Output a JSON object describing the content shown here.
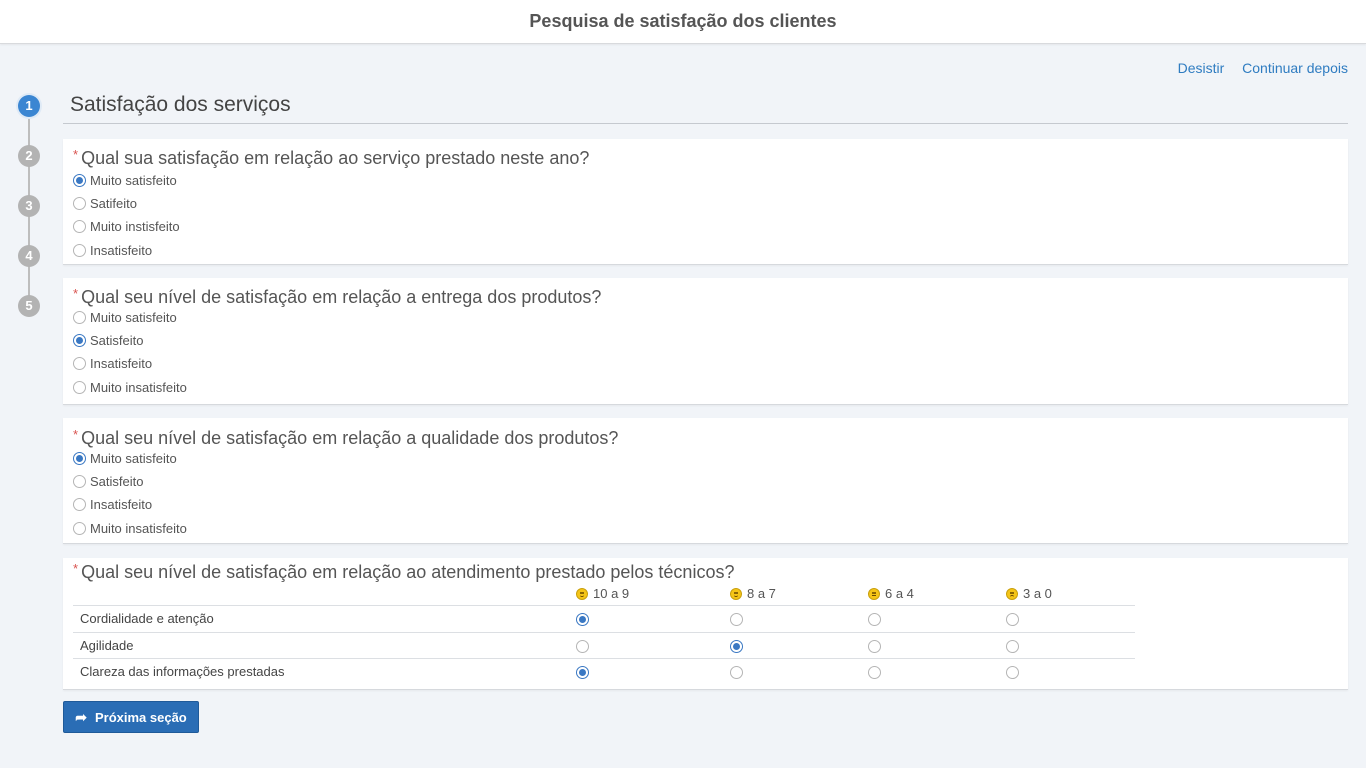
{
  "header": {
    "title": "Pesquisa de satisfação dos clientes"
  },
  "links": {
    "quit": "Desistir",
    "continue_later": "Continuar depois"
  },
  "steps": [
    "1",
    "2",
    "3",
    "4",
    "5"
  ],
  "active_step": 1,
  "section": {
    "title": "Satisfação dos serviços"
  },
  "questions": [
    {
      "required": "*",
      "title": "Qual sua satisfação em relação ao serviço prestado neste ano?",
      "options": [
        "Muito satisfeito",
        "Satifeito",
        "Muito instisfeito",
        "Insatisfeito"
      ],
      "selected": 0
    },
    {
      "required": "*",
      "title": "Qual seu nível de satisfação em relação a entrega dos produtos?",
      "options": [
        "Muito satisfeito",
        "Satisfeito",
        "Insatisfeito",
        "Muito insatisfeito"
      ],
      "selected": 1
    },
    {
      "required": "*",
      "title": "Qual seu nível de satisfação em relação a qualidade dos produtos?",
      "options": [
        "Muito satisfeito",
        "Satisfeito",
        "Insatisfeito",
        "Muito insatisfeito"
      ],
      "selected": 0
    }
  ],
  "matrix_question": {
    "required": "*",
    "title": "Qual seu nível de satisfação em relação ao atendimento prestado pelos técnicos?",
    "columns": [
      {
        "label": "10 a 9",
        "icon": "smiling-face-icon"
      },
      {
        "label": "8 a 7",
        "icon": "smiling-face-icon"
      },
      {
        "label": "6 a 4",
        "icon": "neutral-face-icon"
      },
      {
        "label": "3 a 0",
        "icon": "frowning-face-icon"
      }
    ],
    "rows": [
      {
        "label": "Cordialidade e atenção",
        "selected": 0
      },
      {
        "label": "Agilidade",
        "selected": 1
      },
      {
        "label": "Clareza das informações prestadas",
        "selected": 0
      }
    ]
  },
  "next_button": {
    "label": "Próxima seção",
    "icon": "share-arrow-icon"
  },
  "colors": {
    "accent": "#3b86d2",
    "button": "#2a6db5",
    "link": "#2f7cc1",
    "required": "#d9534f"
  }
}
